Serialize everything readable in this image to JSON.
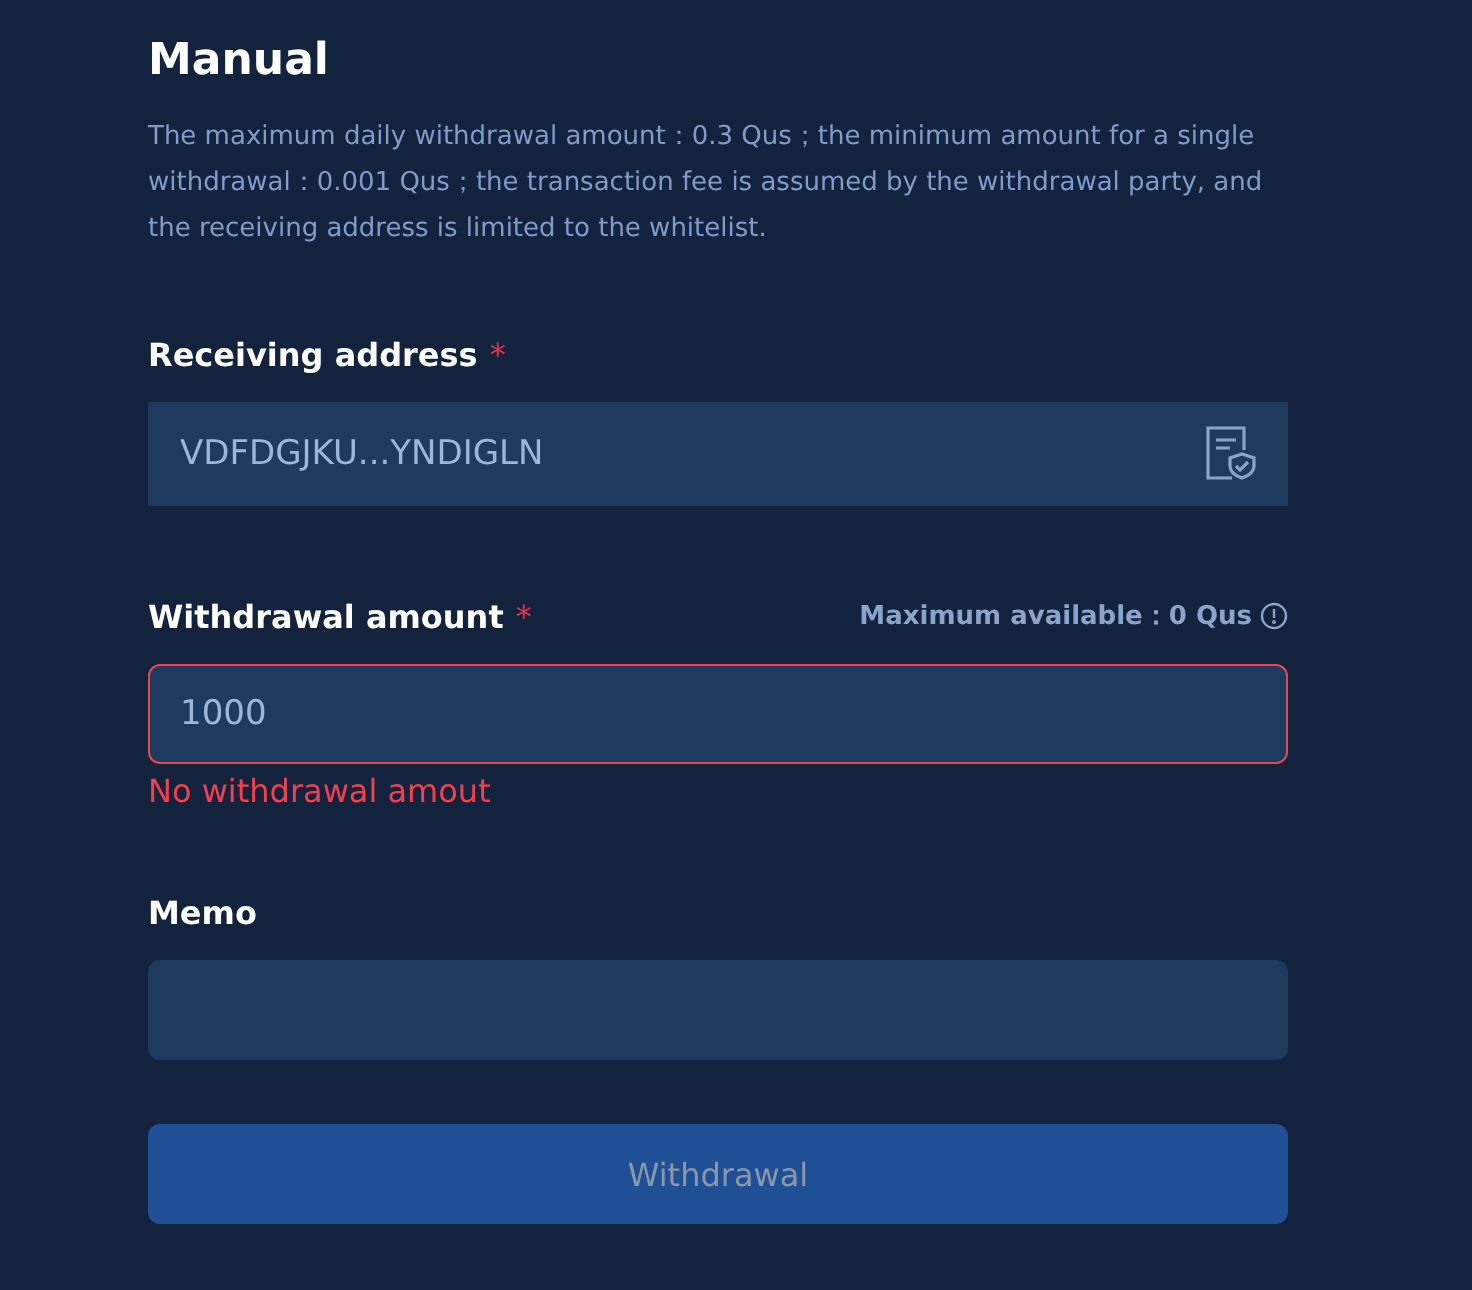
{
  "title": "Manual",
  "notice": "The maximum daily withdrawal amount：0.3 Qus；the minimum amount for a single withdrawal：0.001 Qus；the transaction fee is assumed by the withdrawal party, and the receiving address is limited to the whitelist.",
  "fields": [
    {
      "kind": "address",
      "label": "Receiving address",
      "required_mark": "*",
      "value": "VDFDGJKU...YNDIGLN"
    },
    {
      "kind": "amount",
      "label": "Withdrawal amount",
      "required_mark": "*",
      "hint": "Maximum available：0 Qus",
      "value": "1000",
      "error": "No withdrawal amout"
    },
    {
      "kind": "memo",
      "label": "Memo"
    }
  ],
  "submit": {
    "label": "Withdrawal",
    "disabled": true
  }
}
